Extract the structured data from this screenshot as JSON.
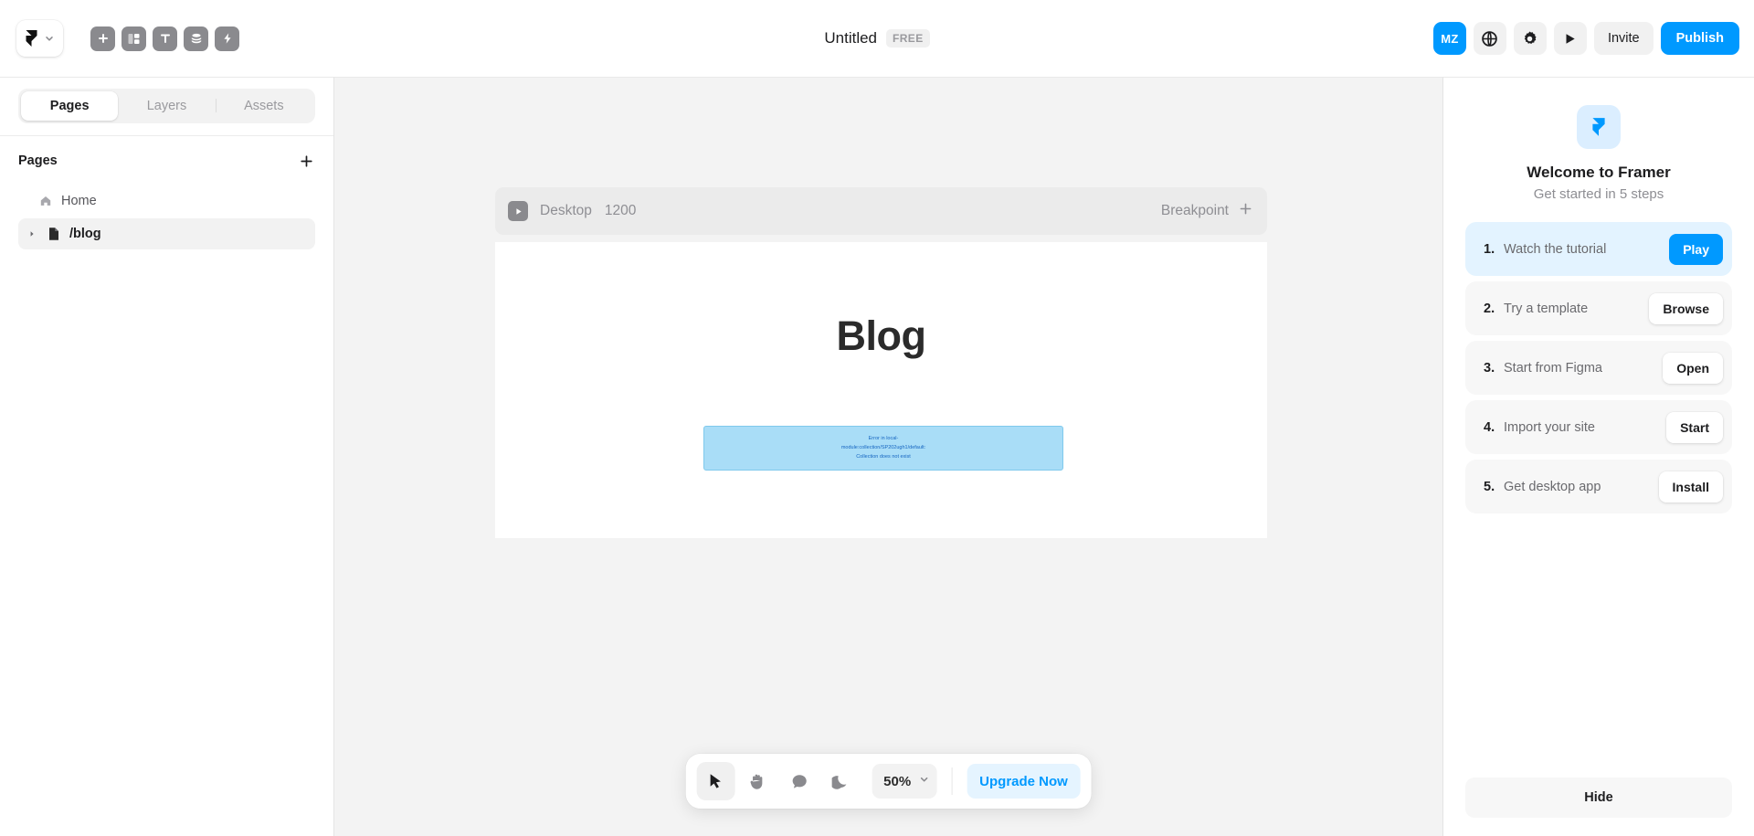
{
  "header": {
    "logo_icon": "framer-logo-icon",
    "logo_chevron_icon": "chevron-down-icon",
    "tools": [
      {
        "icon": "plus-insert-icon",
        "name": "insert"
      },
      {
        "icon": "layout-columns-icon",
        "name": "layout"
      },
      {
        "icon": "text-tool-icon",
        "name": "text"
      },
      {
        "icon": "cms-database-icon",
        "name": "cms"
      },
      {
        "icon": "lightning-effects-icon",
        "name": "effects"
      }
    ],
    "title": "Untitled",
    "plan_badge": "FREE",
    "avatar_initials": "MZ",
    "globe_icon": "globe-icon",
    "settings_icon": "gear-icon",
    "preview_icon": "play-icon",
    "invite_label": "Invite",
    "publish_label": "Publish",
    "accent_color": "#0099ff"
  },
  "sidebar": {
    "tabs": [
      {
        "label": "Pages",
        "active": true
      },
      {
        "label": "Layers",
        "active": false
      },
      {
        "label": "Assets",
        "active": false
      }
    ],
    "section_label": "Pages",
    "add_icon": "plus-icon",
    "pages": [
      {
        "label": "Home",
        "icon": "home-icon",
        "selected": false,
        "has_caret": false
      },
      {
        "label": "/blog",
        "icon": "page-file-icon",
        "selected": true,
        "has_caret": true
      }
    ]
  },
  "canvas": {
    "breakpoint": {
      "play_icon": "play-icon",
      "name": "Desktop",
      "width": "1200",
      "right_label": "Breakpoint",
      "add_icon": "plus-icon"
    },
    "frame": {
      "heading": "Blog",
      "error_box": {
        "background": "#a9ddf7",
        "border": "#7fc9ec",
        "text_color": "#1565c0",
        "lines": [
          "Error in local-",
          "module:collection/SP202ugh1/default:",
          "Collection does not exist"
        ]
      }
    },
    "toolbar": {
      "tools": [
        {
          "icon": "cursor-arrow-icon",
          "name": "select",
          "active": true
        },
        {
          "icon": "hand-icon",
          "name": "pan",
          "active": false
        },
        {
          "icon": "comment-icon",
          "name": "comment",
          "active": false
        },
        {
          "icon": "moon-icon",
          "name": "dark-mode",
          "active": false
        }
      ],
      "zoom_value": "50%",
      "zoom_chevron_icon": "chevron-down-icon",
      "upgrade_label": "Upgrade Now"
    }
  },
  "right_panel": {
    "logo_icon": "framer-logo-icon",
    "title": "Welcome to Framer",
    "subtitle": "Get started in 5 steps",
    "steps": [
      {
        "num": "1.",
        "label": "Watch the tutorial",
        "button": "Play",
        "primary": true,
        "highlight": true
      },
      {
        "num": "2.",
        "label": "Try a template",
        "button": "Browse",
        "primary": false,
        "highlight": false
      },
      {
        "num": "3.",
        "label": "Start from Figma",
        "button": "Open",
        "primary": false,
        "highlight": false
      },
      {
        "num": "4.",
        "label": "Import your site",
        "button": "Start",
        "primary": false,
        "highlight": false
      },
      {
        "num": "5.",
        "label": "Get desktop app",
        "button": "Install",
        "primary": false,
        "highlight": false
      }
    ],
    "hide_label": "Hide"
  }
}
